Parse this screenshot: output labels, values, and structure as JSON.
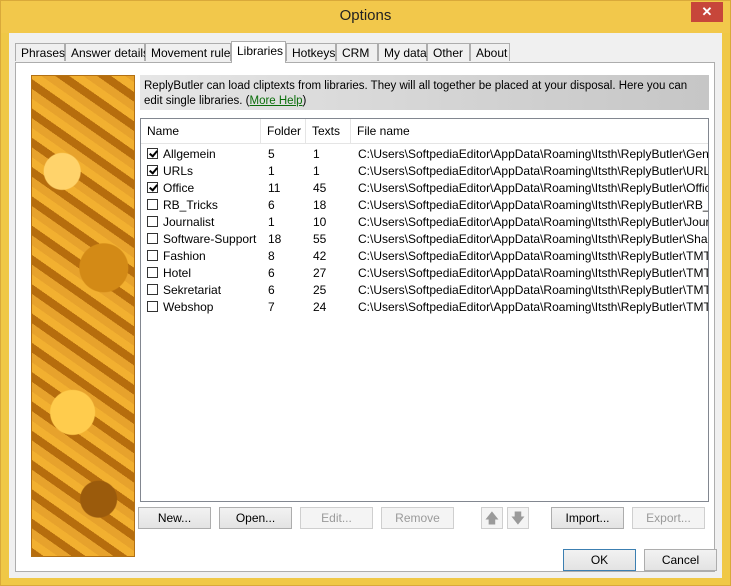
{
  "window": {
    "title": "Options",
    "close_glyph": "✕"
  },
  "tabs": [
    {
      "label": "Phrases",
      "active": false
    },
    {
      "label": "Answer details",
      "active": false
    },
    {
      "label": "Movement rules",
      "active": false
    },
    {
      "label": "Libraries",
      "active": true
    },
    {
      "label": "Hotkeys",
      "active": false
    },
    {
      "label": "CRM",
      "active": false
    },
    {
      "label": "My data",
      "active": false
    },
    {
      "label": "Other",
      "active": false
    },
    {
      "label": "About",
      "active": false
    }
  ],
  "info": {
    "text": "ReplyButler can load cliptexts from libraries. They will all together be placed at your disposal. Here you can edit single libraries.",
    "open_paren": "(",
    "link": "More Help",
    "close_paren": ")"
  },
  "table": {
    "headers": {
      "name": "Name",
      "folder": "Folder",
      "texts": "Texts",
      "file": "File name"
    },
    "rows": [
      {
        "checked": true,
        "name": "Allgemein",
        "folder": "5",
        "texts": "1",
        "file": "C:\\Users\\SoftpediaEditor\\AppData\\Roaming\\Itsth\\ReplyButler\\Gene..."
      },
      {
        "checked": true,
        "name": "URLs",
        "folder": "1",
        "texts": "1",
        "file": "C:\\Users\\SoftpediaEditor\\AppData\\Roaming\\Itsth\\ReplyButler\\URLs..."
      },
      {
        "checked": true,
        "name": "Office",
        "folder": "11",
        "texts": "45",
        "file": "C:\\Users\\SoftpediaEditor\\AppData\\Roaming\\Itsth\\ReplyButler\\Offic..."
      },
      {
        "checked": false,
        "name": "RB_Tricks",
        "folder": "6",
        "texts": "18",
        "file": "C:\\Users\\SoftpediaEditor\\AppData\\Roaming\\Itsth\\ReplyButler\\RB_..."
      },
      {
        "checked": false,
        "name": "Journalist",
        "folder": "1",
        "texts": "10",
        "file": "C:\\Users\\SoftpediaEditor\\AppData\\Roaming\\Itsth\\ReplyButler\\Journ..."
      },
      {
        "checked": false,
        "name": "Software-Support",
        "folder": "18",
        "texts": "55",
        "file": "C:\\Users\\SoftpediaEditor\\AppData\\Roaming\\Itsth\\ReplyButler\\Shar..."
      },
      {
        "checked": false,
        "name": "Fashion",
        "folder": "8",
        "texts": "42",
        "file": "C:\\Users\\SoftpediaEditor\\AppData\\Roaming\\Itsth\\ReplyButler\\TMT-..."
      },
      {
        "checked": false,
        "name": "Hotel",
        "folder": "6",
        "texts": "27",
        "file": "C:\\Users\\SoftpediaEditor\\AppData\\Roaming\\Itsth\\ReplyButler\\TMT-..."
      },
      {
        "checked": false,
        "name": "Sekretariat",
        "folder": "6",
        "texts": "25",
        "file": "C:\\Users\\SoftpediaEditor\\AppData\\Roaming\\Itsth\\ReplyButler\\TMT-..."
      },
      {
        "checked": false,
        "name": "Webshop",
        "folder": "7",
        "texts": "24",
        "file": "C:\\Users\\SoftpediaEditor\\AppData\\Roaming\\Itsth\\ReplyButler\\TMT-..."
      }
    ]
  },
  "buttons": {
    "new": "New...",
    "open": "Open...",
    "edit": "Edit...",
    "remove": "Remove",
    "up": "🡅",
    "down": "🡇",
    "import": "Import...",
    "export": "Export...",
    "ok": "OK",
    "cancel": "Cancel"
  },
  "colors": {
    "title_bar": "#f2c84b",
    "accent": "#3c7fb1",
    "link": "#0a6e0a"
  }
}
